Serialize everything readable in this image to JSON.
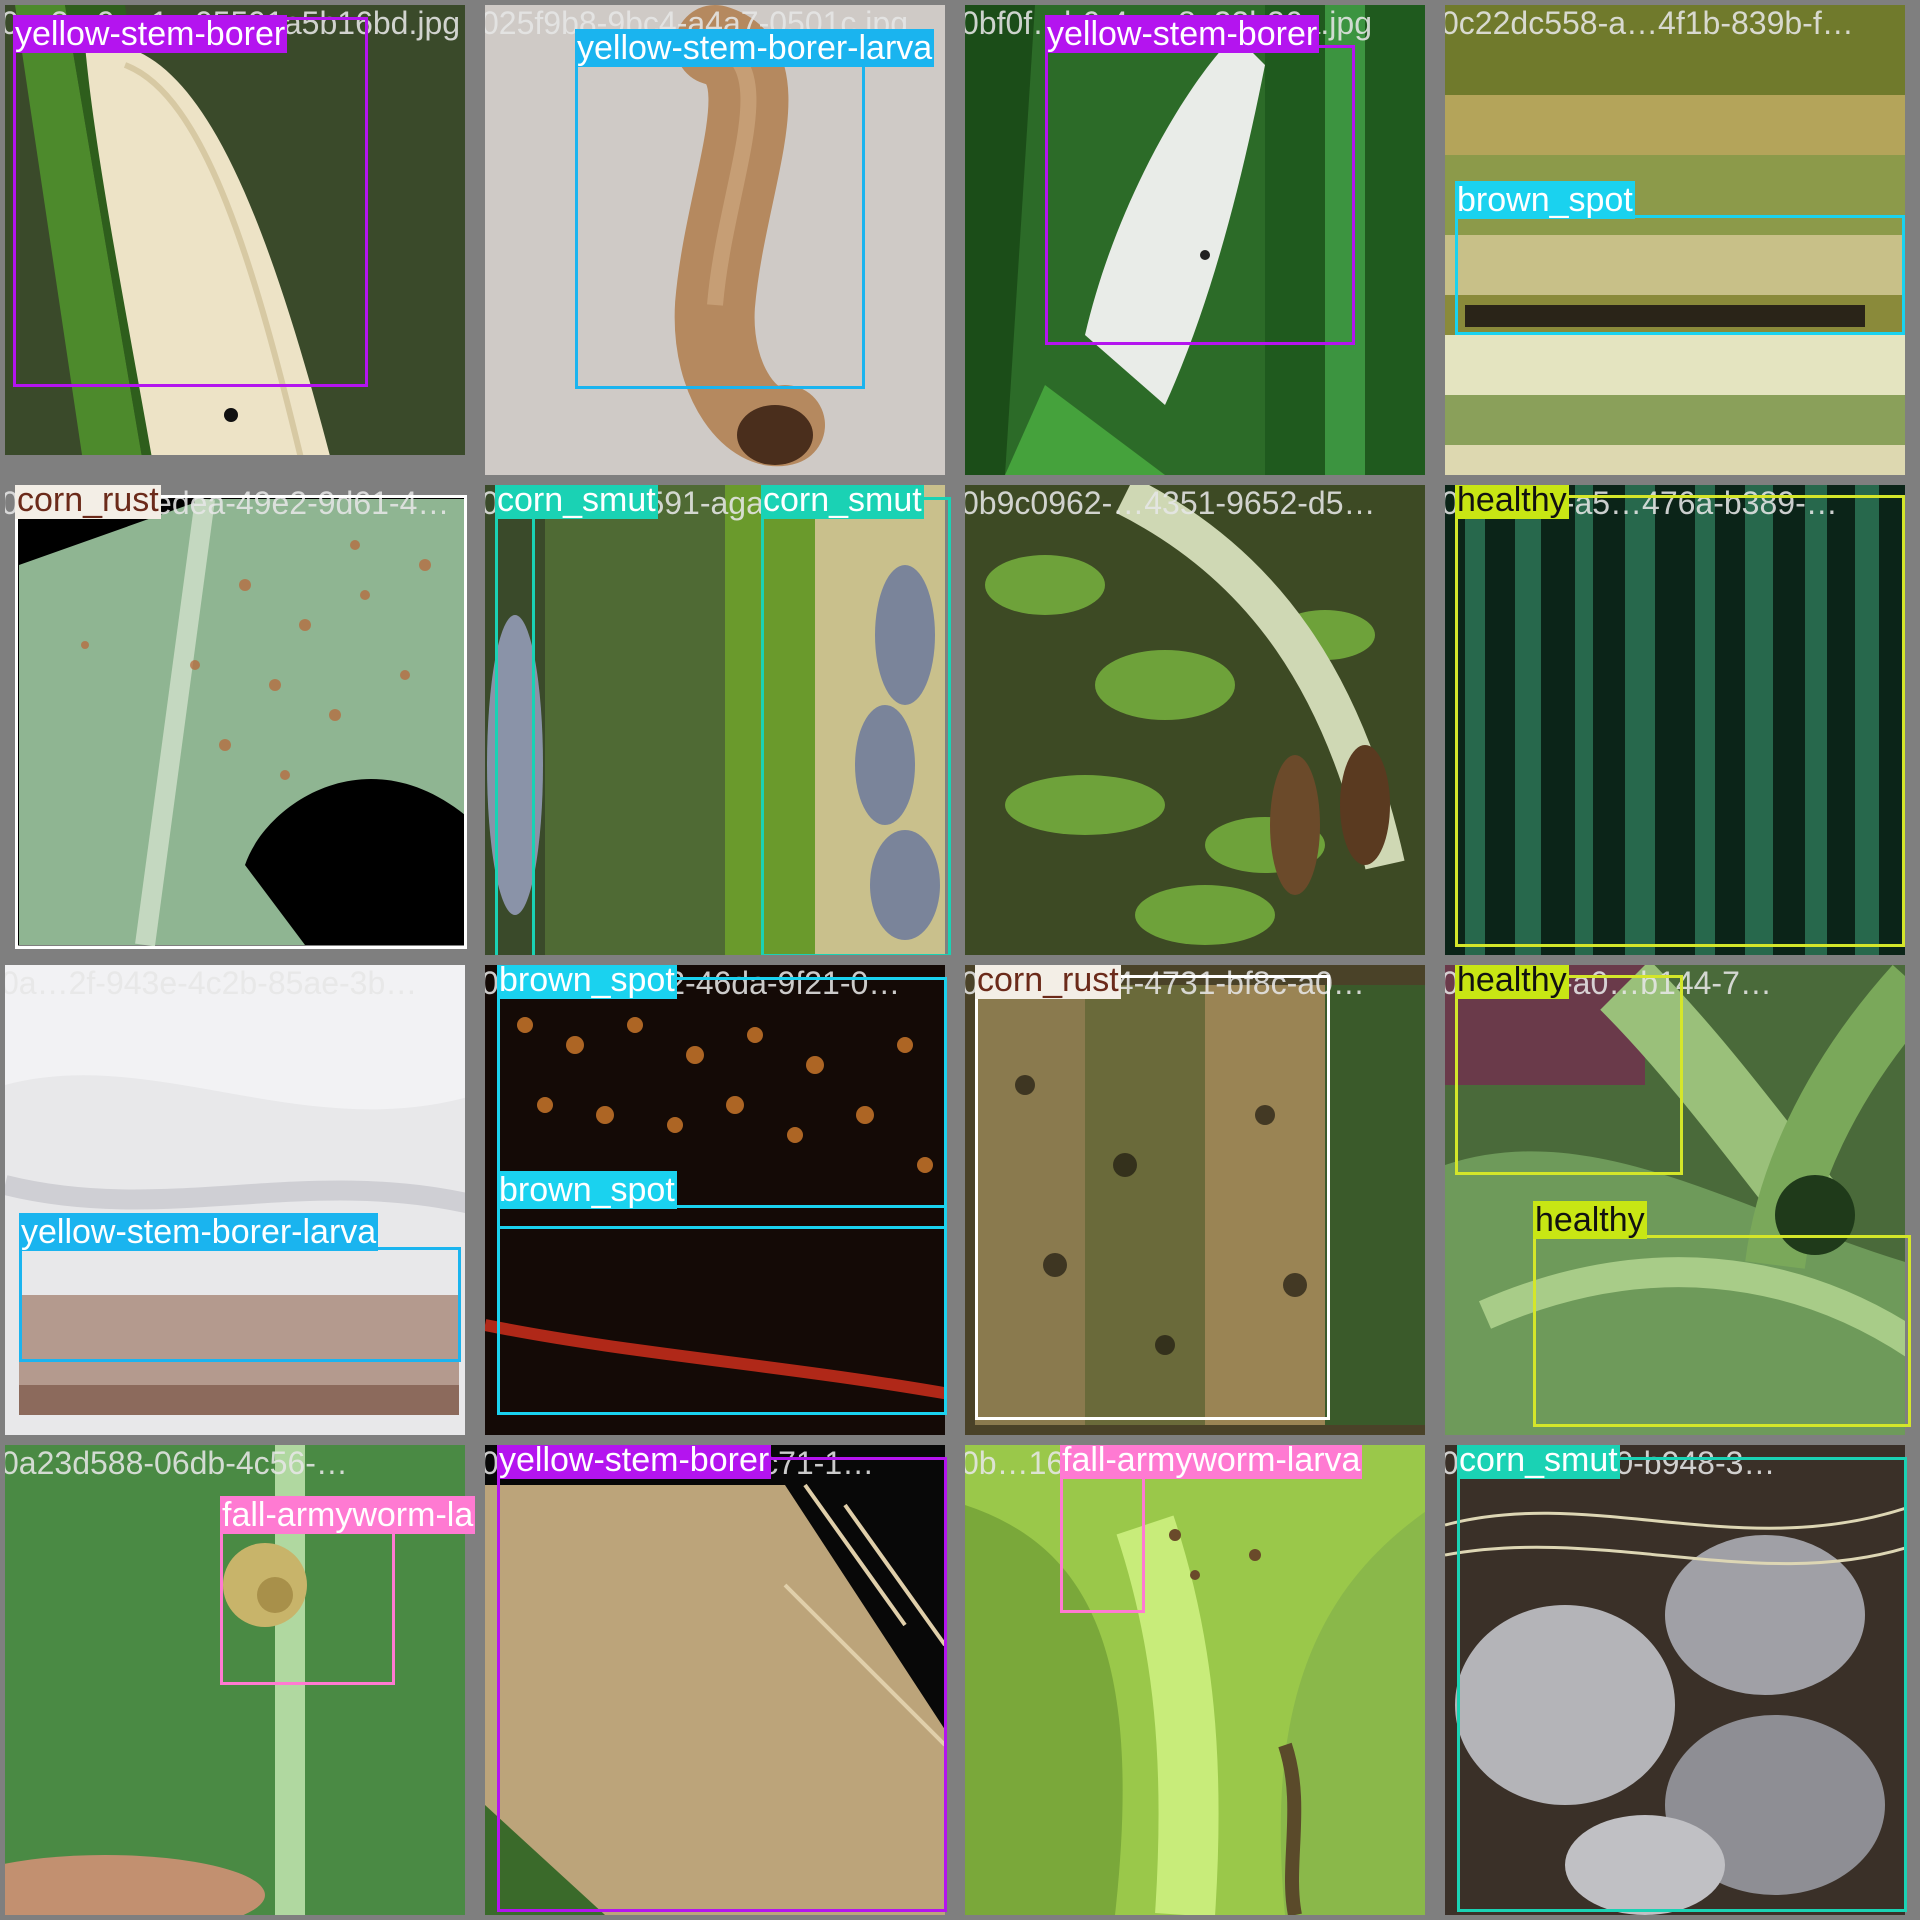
{
  "colors": {
    "yellow-stem-borer": "#b414ef",
    "yellow-stem-borer-larva": "#1ab4ef",
    "corn_rust": "#f3eee6",
    "corn_smut": "#1ad2b4",
    "brown_spot": "#1ad2ef",
    "healthy": "#c8e614",
    "fall-armyworm-larva": "#ff7ad2",
    "healthy_box": "#d4e62a",
    "corn_rust_box": "#ffffff"
  },
  "tiles": [
    {
      "filename": "0…3e-9ea1-c05591a5b16bd.jpg",
      "scene": "moth-white",
      "labels": [
        {
          "text": "yellow-stem-borer",
          "cls": "yellow-stem-borer"
        }
      ]
    },
    {
      "filename": "025f9b8-9bc4-a4a7-0501c.jpg",
      "scene": "larva-closeup",
      "labels": [
        {
          "text": "yellow-stem-borer-larva",
          "cls": "yellow-stem-borer-larva"
        }
      ]
    },
    {
      "filename": "0bf0f…b6-4e…8a22b36a.jpg",
      "scene": "moth-green",
      "labels": [
        {
          "text": "yellow-stem-borer",
          "cls": "yellow-stem-borer"
        }
      ]
    },
    {
      "filename": "0c22dc558-a…4f1b-839b-f…",
      "scene": "blurry-leaf",
      "labels": [
        {
          "text": "brown_spot",
          "cls": "brown_spot"
        }
      ]
    },
    {
      "filename": "0a4632d8-edea-49e2-9d61-4…",
      "scene": "rust-leaf",
      "labels": [
        {
          "text": "corn_rust",
          "cls": "corn_rust"
        }
      ]
    },
    {
      "filename": "0a2…c1-b4591-aga7-b0…",
      "scene": "smut-field",
      "labels": [
        {
          "text": "corn_smut",
          "cls": "corn_smut"
        },
        {
          "text": "corn_smut",
          "cls": "corn_smut"
        }
      ]
    },
    {
      "filename": "0b9c0962-…4351-9652-d5…",
      "scene": "weeds",
      "labels": []
    },
    {
      "filename": "0a8c045-a5…476a-b389-…",
      "scene": "dark-stripes",
      "labels": [
        {
          "text": "healthy",
          "cls": "healthy"
        }
      ]
    },
    {
      "filename": "0a…2f-943e-4c2b-85ae-3b…",
      "scene": "white-cloth",
      "labels": [
        {
          "text": "yellow-stem-borer-larva",
          "cls": "yellow-stem-borer-larva"
        }
      ]
    },
    {
      "filename": "0ad1106e-0e2-46da-9f21-0…",
      "scene": "dark-spots",
      "labels": [
        {
          "text": "brown_spot",
          "cls": "brown_spot"
        },
        {
          "text": "brown_spot",
          "cls": "brown_spot"
        }
      ]
    },
    {
      "filename": "0b52…31c4-4731-bf8c-a0…",
      "scene": "rust-stalks",
      "labels": [
        {
          "text": "corn_rust",
          "cls": "corn_rust"
        }
      ]
    },
    {
      "filename": "0a0…e4-a0…b144-7…",
      "scene": "young-maize",
      "labels": [
        {
          "text": "healthy",
          "cls": "healthy"
        },
        {
          "text": "healthy",
          "cls": "healthy"
        }
      ]
    },
    {
      "filename": "0a23d588-06db-4c56-…",
      "scene": "green-leaf-larva",
      "labels": [
        {
          "text": "fall-armyworm-larva",
          "cls": "fall-armyworm-larva"
        }
      ]
    },
    {
      "filename": "0b2c…9c30-4a75-ac71-1…",
      "scene": "dry-tassel",
      "labels": [
        {
          "text": "yellow-stem-borer",
          "cls": "yellow-stem-borer"
        }
      ]
    },
    {
      "filename": "0b…16-4c8c-956c-0…",
      "scene": "armyworm-whorl",
      "labels": [
        {
          "text": "fall-armyworm-larva",
          "cls": "fall-armyworm-larva"
        }
      ]
    },
    {
      "filename": "0c4…3f-4330-b948-3…",
      "scene": "smut-galls",
      "labels": [
        {
          "text": "corn_smut",
          "cls": "corn_smut"
        }
      ]
    }
  ]
}
